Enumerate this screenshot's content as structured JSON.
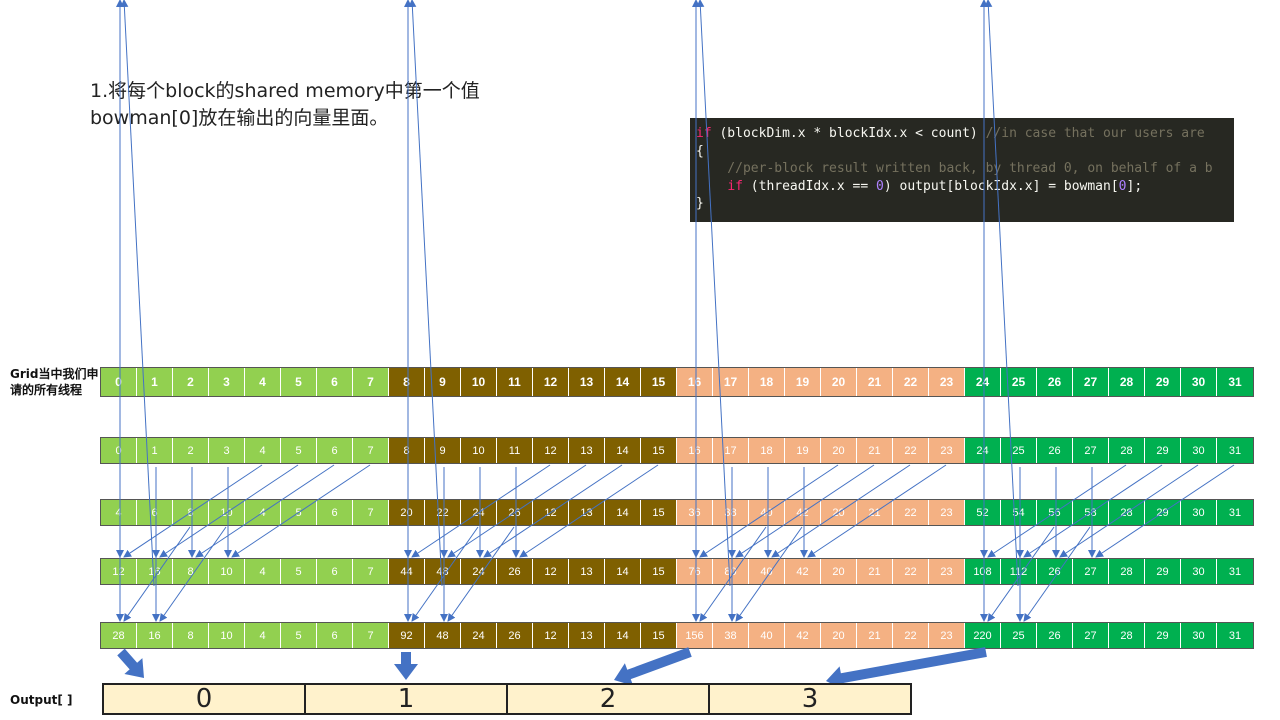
{
  "title": {
    "line1": "1.将每个block的shared  memory中第一个值",
    "line2": "bowman[0]放在输出的向量里面。"
  },
  "code": {
    "line1_kw": "if",
    "line1_text": " (blockDim.x * blockIdx.x < count) ",
    "line1_comment": "//in case that our users are",
    "line2": "{",
    "line3_comment": "    //per-block result written back, by thread 0, on behalf of a b",
    "line4_indent": "    ",
    "line4_kw": "if",
    "line4_text_a": " (threadIdx.x == ",
    "line4_num": "0",
    "line4_text_b": ") output[blockIdx.x] = bowman[",
    "line4_num2": "0",
    "line4_text_c": "];",
    "line5": "}"
  },
  "grid_label": "Grid当中我们申请的所有线程",
  "output_label": "Output[ ]",
  "block_colors": [
    "#92d050",
    "#7f6000",
    "#f4b183",
    "#00b050"
  ],
  "arrow_color": "#4472c4",
  "rows": [
    [
      "0",
      "1",
      "2",
      "3",
      "4",
      "5",
      "6",
      "7",
      "8",
      "9",
      "10",
      "11",
      "12",
      "13",
      "14",
      "15",
      "16",
      "17",
      "18",
      "19",
      "20",
      "21",
      "22",
      "23",
      "24",
      "25",
      "26",
      "27",
      "28",
      "29",
      "30",
      "31"
    ],
    [
      "0",
      "1",
      "2",
      "3",
      "4",
      "5",
      "6",
      "7",
      "8",
      "9",
      "10",
      "11",
      "12",
      "13",
      "14",
      "15",
      "16",
      "17",
      "18",
      "19",
      "20",
      "21",
      "22",
      "23",
      "24",
      "25",
      "26",
      "27",
      "28",
      "29",
      "30",
      "31"
    ],
    [
      "4",
      "6",
      "8",
      "10",
      "4",
      "5",
      "6",
      "7",
      "20",
      "22",
      "24",
      "26",
      "12",
      "13",
      "14",
      "15",
      "36",
      "38",
      "40",
      "42",
      "20",
      "21",
      "22",
      "23",
      "52",
      "54",
      "56",
      "58",
      "28",
      "29",
      "30",
      "31"
    ],
    [
      "12",
      "16",
      "8",
      "10",
      "4",
      "5",
      "6",
      "7",
      "44",
      "48",
      "24",
      "26",
      "12",
      "13",
      "14",
      "15",
      "76",
      "80",
      "40",
      "42",
      "20",
      "21",
      "22",
      "23",
      "108",
      "112",
      "26",
      "27",
      "28",
      "29",
      "30",
      "31"
    ],
    [
      "28",
      "16",
      "8",
      "10",
      "4",
      "5",
      "6",
      "7",
      "92",
      "48",
      "24",
      "26",
      "12",
      "13",
      "14",
      "15",
      "156",
      "38",
      "40",
      "42",
      "20",
      "21",
      "22",
      "23",
      "220",
      "25",
      "26",
      "27",
      "28",
      "29",
      "30",
      "31"
    ]
  ],
  "output": [
    "0",
    "1",
    "2",
    "3"
  ]
}
